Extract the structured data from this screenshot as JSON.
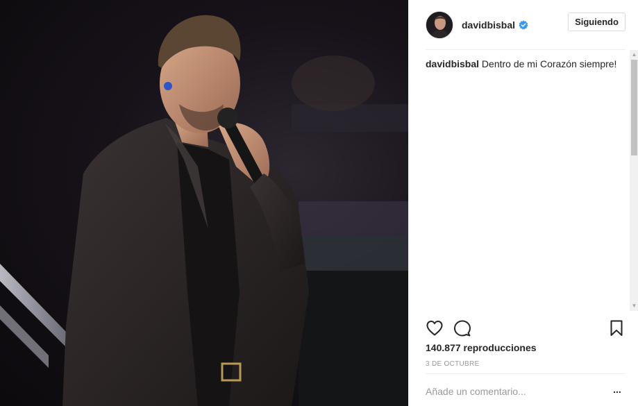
{
  "media": {
    "icon": "concert-photo"
  },
  "header": {
    "username": "davidbisbal",
    "follow_label": "Siguiendo",
    "verified_color": "#3897f0"
  },
  "caption": {
    "username": "davidbisbal",
    "text": "Dentro de mi Corazón siempre!"
  },
  "actions": {
    "like_icon": "heart-icon",
    "comment_icon": "comment-icon",
    "save_icon": "bookmark-icon"
  },
  "stats": {
    "views": "140.877 reproducciones",
    "date": "3 DE OCTUBRE"
  },
  "comment_box": {
    "placeholder": "Añade un comentario...",
    "more_label": "..."
  }
}
